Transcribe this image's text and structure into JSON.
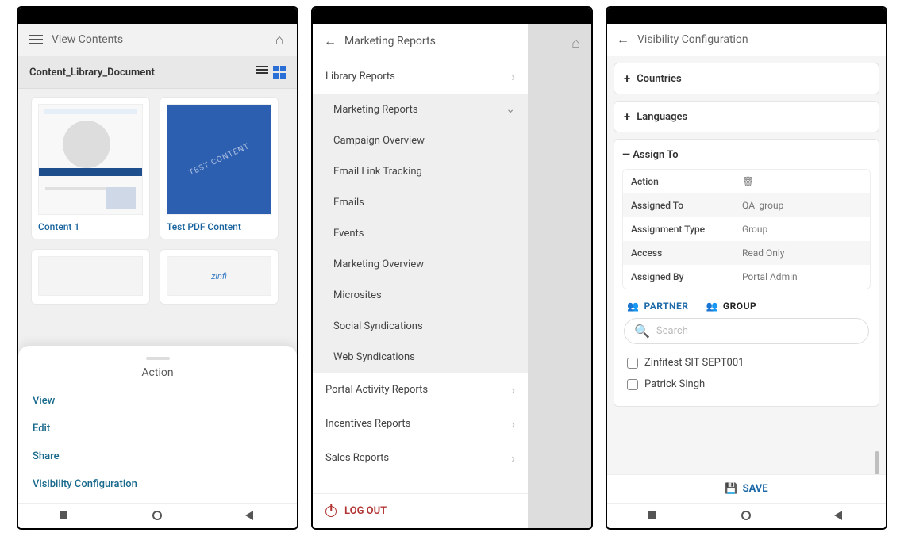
{
  "phone1": {
    "header": {
      "title": "View Contents"
    },
    "section_title": "Content_Library_Document",
    "cards": [
      {
        "caption": "Content 1"
      },
      {
        "caption": "Test PDF Content",
        "thumb_text": "TEST CONTENT"
      }
    ],
    "sheet": {
      "title": "Action",
      "items": [
        "View",
        "Edit",
        "Share",
        "Visibility Configuration"
      ]
    }
  },
  "phone2": {
    "header": {
      "title": "Marketing Reports"
    },
    "menu": {
      "library": "Library Reports",
      "marketing": "Marketing Reports",
      "subs": [
        "Campaign Overview",
        "Email Link Tracking",
        "Emails",
        "Events",
        "Marketing Overview",
        "Microsites",
        "Social Syndications",
        "Web Syndications"
      ],
      "after": [
        "Portal Activity Reports",
        "Incentives Reports",
        "Sales Reports"
      ]
    },
    "logout": "LOG OUT"
  },
  "phone3": {
    "header": {
      "title": "Visibility Configuration"
    },
    "accordions": {
      "countries": "Countries",
      "languages": "Languages",
      "assign_to": "Assign To"
    },
    "table": {
      "rows": [
        {
          "k": "Action",
          "v": ""
        },
        {
          "k": "Assigned To",
          "v": "QA_group"
        },
        {
          "k": "Assignment Type",
          "v": "Group"
        },
        {
          "k": "Access",
          "v": "Read Only"
        },
        {
          "k": "Assigned By",
          "v": "Portal Admin"
        }
      ]
    },
    "tabs": {
      "partner": "PARTNER",
      "group": "GROUP"
    },
    "search_placeholder": "Search",
    "partners": [
      "Zinfitest SIT SEPT001",
      "Patrick Singh"
    ],
    "save": "SAVE"
  }
}
